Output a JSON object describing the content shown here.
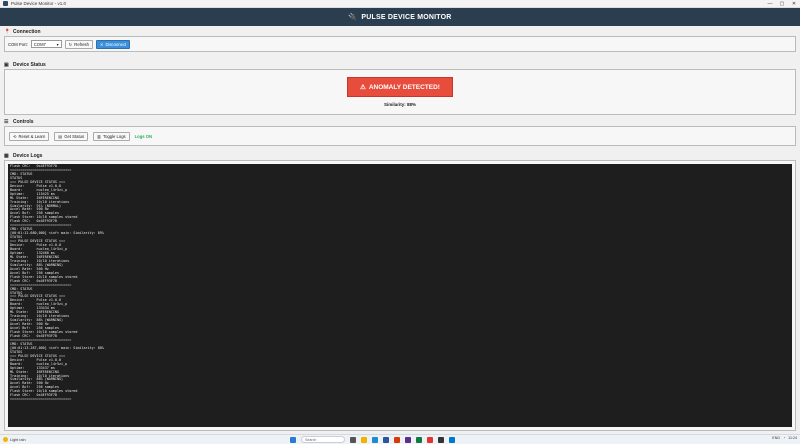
{
  "window": {
    "title": "Pulse Device Monitor - v1.0",
    "controls": [
      "—",
      "▢",
      "✕"
    ]
  },
  "header": {
    "title": "PULSE DEVICE MONITOR",
    "icon": "plug-icon"
  },
  "connection": {
    "section_title": "Connection",
    "com_port_label": "COM Port:",
    "com_port_value": "COM7",
    "refresh_label": "Refresh",
    "disconnect_label": "Disconnect"
  },
  "device_status": {
    "section_title": "Device Status",
    "alert_text": "ANOMALY DETECTED!",
    "alert_color": "#e74c3c",
    "similarity_text": "Similarity: 88%"
  },
  "controls": {
    "section_title": "Controls",
    "reset_label": "Reset & Learn",
    "status_label": "Get Status",
    "toggle_label": "Toggle Logs",
    "logs_state": "Logs ON"
  },
  "logs": {
    "section_title": "Device Logs",
    "lines": [
      "Flash CRC:   0x4EF93F78",
      "==============================",
      "CMD: STATUS",
      "STATUS",
      "=== PULSE DEVICE STATUS ===",
      "Device:      Pulse v1.0.0",
      "Board:       nucleo_l4r5zi_p",
      "Uptime:      115425 ms",
      "ML State:    INFERENCING",
      "Training:    10/10 iterations",
      "Similarity:  91% (NORMAL)",
      "Accel Rate:  500 Hz",
      "Accel Buf:   256 samples",
      "Flash Store: 10/10 samples stored",
      "Flash CRC:   0x4EF93F78",
      "==============================",
      "CMD: STATUS",
      "[00:01:12.680,000] <inf> main: Similarity: 89%",
      "STATUS",
      "=== PULSE DEVICE STATUS ===",
      "Device:      Pulse v1.0.0",
      "Board:       nucleo_l4r5zi_p",
      "Uptime:      132460 ms",
      "ML State:    INFERENCING",
      "Training:    10/10 iterations",
      "Similarity:  88% (WARNING)",
      "Accel Rate:  500 Hz",
      "Accel Buf:   256 samples",
      "Flash Store: 10/10 samples stored",
      "Flash CRC:   0x4EF93F78",
      "==============================",
      "CMD: STATUS",
      "STATUS",
      "=== PULSE DEVICE STATUS ===",
      "Device:      Pulse v1.0.0",
      "Board:       nucleo_l4r5zi_p",
      "Uptime:      133434 ms",
      "ML State:    INFERENCING",
      "Training:    10/10 iterations",
      "Similarity:  88% (WARNING)",
      "Accel Rate:  500 Hz",
      "Accel Buf:   256 samples",
      "Flash Store: 10/10 samples stored",
      "Flash CRC:   0x4EF93F78",
      "==============================",
      "CMD: STATUS",
      "[00:01:13.287,000] <inf> main: Similarity: 88%",
      "STATUS",
      "=== PULSE DEVICE STATUS ===",
      "Device:      Pulse v1.0.0",
      "Board:       nucleo_l4r5zi_p",
      "Uptime:      133437 ms",
      "ML State:    INFERENCING",
      "Training:    10/10 iterations",
      "Similarity:  88% (WARNING)",
      "Accel Rate:  500 Hz",
      "Accel Buf:   256 samples",
      "Flash Store: 10/10 samples stored",
      "Flash CRC:   0x4EF93F78",
      "=============================="
    ]
  },
  "taskbar": {
    "weather": "Light rain",
    "search_placeholder": "Search",
    "tray_lang": "ENG",
    "time": "11:24"
  }
}
